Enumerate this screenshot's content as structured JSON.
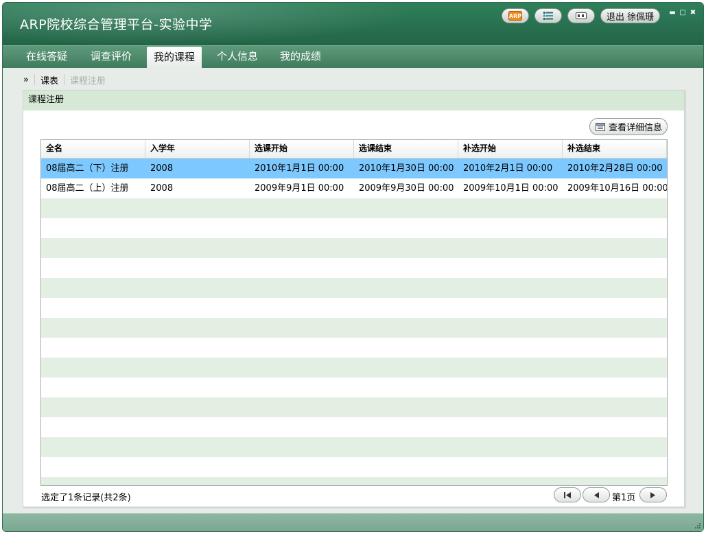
{
  "app": {
    "title": "ARP院校综合管理平台-实验中学",
    "logout_label": "退出 徐佩珊",
    "toolbar_icons": [
      "arp-logo-icon",
      "list-icon",
      "card-icon"
    ]
  },
  "nav": {
    "tabs": [
      {
        "label": "在线答疑",
        "active": false
      },
      {
        "label": "调查评价",
        "active": false
      },
      {
        "label": "我的课程",
        "active": true
      },
      {
        "label": "个人信息",
        "active": false
      },
      {
        "label": "我的成绩",
        "active": false
      }
    ]
  },
  "breadcrumb": {
    "marker": "»",
    "items": [
      "课表",
      "课程注册"
    ]
  },
  "panel": {
    "title": "课程注册",
    "detail_button_label": "查看详细信息"
  },
  "table": {
    "columns": [
      "全名",
      "入学年",
      "选课开始",
      "选课结束",
      "补选开始",
      "补选结束"
    ],
    "rows": [
      [
        "08届高二（下）注册",
        "2008",
        "2010年1月1日 00:00",
        "2010年1月30日 00:00",
        "2010年2月1日 00:00",
        "2010年2月28日 00:00"
      ],
      [
        "08届高二（上）注册",
        "2008",
        "2009年9月1日 00:00",
        "2009年9月30日 00:00",
        "2009年10月1日 00:00",
        "2009年10月16日 00:00"
      ]
    ],
    "selected_row": 0
  },
  "status": {
    "selection_text": "选定了1条记录(共2条)",
    "page_label": "第1页"
  },
  "colors": {
    "title_bar": "#2a7352",
    "nav_bar": "#4a8a69",
    "panel_header": "#d6e8d6",
    "selected_row": "#7dc9ff",
    "alt_row": "#e4efe4",
    "footer": "#86b29b"
  }
}
